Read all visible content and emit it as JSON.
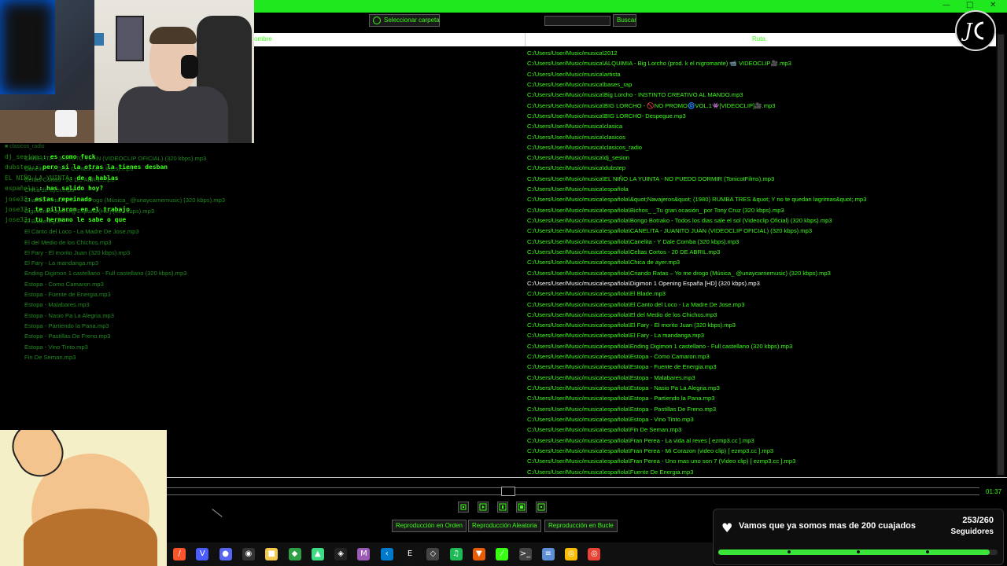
{
  "toolbar": {
    "select_folder_label": "Seleccionar carpeta",
    "search_value": "",
    "search_label": "Buscar"
  },
  "columns": {
    "name": "ombre",
    "path": "Ruta"
  },
  "files_right": [
    "C:/Users/User/Music/musica\\2012",
    "C:/Users/User/Music/musica\\ALQUIMIA - Big Lorcho (prod. k el nigromante) 📹 VIDEOCLIP🎥.mp3",
    "C:/Users/User/Music/musica\\artista",
    "C:/Users/User/Music/musica\\bases_rap",
    "C:/Users/User/Music/musica\\Big Lorcho - INSTINTO CREATIVO AL MANDO.mp3",
    "C:/Users/User/Music/musica\\BIG LORCHO - 🚫NO PROMO🌀VOL.1👾[VIDEOCLIP]🎥.mp3",
    "C:/Users/User/Music/musica\\BIG LORCHO- Despegue.mp3",
    "C:/Users/User/Music/musica\\clasica",
    "C:/Users/User/Music/musica\\clasicos",
    "C:/Users/User/Music/musica\\clasicos_radio",
    "C:/Users/User/Music/musica\\dj_sesion",
    "C:/Users/User/Music/musica\\dubstep",
    "C:/Users/User/Music/musica\\EL NIÑO LA YUINTA - NO PUEDO DORMIR (TonicotFilms).mp3",
    "C:/Users/User/Music/musica\\española",
    "C:/Users/User/Music/musica\\española\\&quot;Navajeros&quot; (1980) RUMBA TRES &quot; Y no te quedan lagrimas&quot;.mp3",
    "C:/Users/User/Music/musica\\española\\Bichos_ _Tu gran ocasión_ por Tony Cruz (320 kbps).mp3",
    "C:/Users/User/Music/musica\\española\\Bongo Botrako - Todos los dias sale el sol (Videoclip Oficial) (320 kbps).mp3",
    "C:/Users/User/Music/musica\\española\\CANELITA - JUANITO JUAN (VIDEOCLIP OFICIAL) (320 kbps).mp3",
    "C:/Users/User/Music/musica\\española\\Canelita - Y Dale Comba (320 kbps).mp3",
    "C:/Users/User/Music/musica\\española\\Celtas Cortos - 20 DE ABRIL.mp3",
    "C:/Users/User/Music/musica\\española\\Chica de ayer.mp3",
    "C:/Users/User/Music/musica\\española\\Criando Ratas – Yo me drogo (Música_ @unaycarnemusic) (320 kbps).mp3",
    "C:/Users/User/Music/musica\\española\\Digimon 1 Opening España [HD] (320 kbps).mp3",
    "C:/Users/User/Music/musica\\española\\El Blade.mp3",
    "C:/Users/User/Music/musica\\española\\El Canto del Loco - La Madre De Jose.mp3",
    "C:/Users/User/Music/musica\\española\\El del Medio de los Chichos.mp3",
    "C:/Users/User/Music/musica\\española\\El Fary - El morito Juan (320 kbps).mp3",
    "C:/Users/User/Music/musica\\española\\El Fary - La mandanga.mp3",
    "C:/Users/User/Music/musica\\española\\Ending Digimon 1 castellano - Full castellano (320 kbps).mp3",
    "C:/Users/User/Music/musica\\española\\Estopa - Como Camaron.mp3",
    "C:/Users/User/Music/musica\\española\\Estopa - Fuente de Energia.mp3",
    "C:/Users/User/Music/musica\\española\\Estopa - Malabares.mp3",
    "C:/Users/User/Music/musica\\española\\Estopa - Nasio Pa La Alegria.mp3",
    "C:/Users/User/Music/musica\\española\\Estopa - Partiendo la Pana.mp3",
    "C:/Users/User/Music/musica\\española\\Estopa - Pastillas De Freno.mp3",
    "C:/Users/User/Music/musica\\española\\Estopa - Vino Tinto.mp3",
    "C:/Users/User/Music/musica\\española\\Fin De Seman.mp3",
    "C:/Users/User/Music/musica\\española\\Fran Perea - La vida al reves [ ezmp3.cc ].mp3",
    "C:/Users/User/Music/musica\\española\\Fran Perea - Mi Corazon (video clip) [ ezmp3.cc ].mp3",
    "C:/Users/User/Music/musica\\española\\Fran Perea - Uno mas uno son 7 (Video clip) [ ezmp3.cc ].mp3",
    "C:/Users/User/Music/musica\\española\\Fuente De Energia.mp3"
  ],
  "selected_index": 22,
  "files_left": [
    "CANELITA - JUANITO JUAN (VIDEOCLIP OFICIAL) (320 kbps).mp3",
    "Canelita - Y Dale Comba (320 kbps).mp3",
    "Celtas Cortos - 20 DE ABRIL.mp3",
    "Chica de ayer.mp3",
    "Criando Ratas – Yo me drogo (Música_ @unaycarnemusic) (320 kbps).mp3",
    "Digimon 1 Opening España [HD] (320 kbps).mp3",
    "El Blade.mp3",
    "El Canto del Loco - La Madre De Jose.mp3",
    "El del Medio de los Chichos.mp3",
    "El Fary - El morito Juan (320 kbps).mp3",
    "El Fary - La mandanga.mp3",
    "Ending Digimon 1 castellano - Full castellano (320 kbps).mp3",
    "Estopa - Como Camaron.mp3",
    "Estopa - Fuente de Energia.mp3",
    "Estopa - Malabares.mp3",
    "Estopa - Nasio Pa La Alegria.mp3",
    "Estopa - Partiendo la Pana.mp3",
    "Estopa - Pastillas De Freno.mp3",
    "Estopa - Vino Tinto.mp3",
    "Fin De Seman.mp3"
  ],
  "chat": {
    "channel": "clasicos_radio",
    "messages": [
      {
        "user": "dj_sesion:",
        "text": ": es como fuck"
      },
      {
        "user": "dubstep:",
        "text": ": pero si la otras la tienes desban"
      },
      {
        "user": "EL NIÑO LA YUINTA",
        "text": ": de q hablas"
      },
      {
        "user": "española:",
        "text": ": has salido hoy?"
      },
      {
        "user": "jose33",
        "text": ": estas repeinado"
      },
      {
        "user": "jose33",
        "text": ": te pillaron en el trabajo"
      },
      {
        "user": "jose33",
        "text": ": tu hermano le sabe o que"
      }
    ]
  },
  "player": {
    "time": "01:37",
    "progress": 0.42,
    "modes": [
      "Reproducción en Orden",
      "Reproducción Aleatoria",
      "Reproducción en Bucle"
    ]
  },
  "taskbar_icons": [
    "brave-icon",
    "vivaldi-icon",
    "discord-icon",
    "obs-icon",
    "folder-icon",
    "github-icon",
    "android-studio-icon",
    "unity-icon",
    "visual-studio-icon",
    "vscode-icon",
    "epic-icon",
    "unity-hub-icon",
    "spotify-icon",
    "brave-lion-icon",
    "pen-icon",
    "terminal-icon",
    "notepad-icon",
    "chrome-icon",
    "chrome-alt-icon"
  ],
  "followers": {
    "goal_text": "Vamos que ya somos mas de 200 cuajados",
    "count": "253/260",
    "label": "Seguidores",
    "current": 253,
    "target": 260
  },
  "colors": {
    "accent": "#39ff14",
    "bar": "#1fe81f"
  }
}
